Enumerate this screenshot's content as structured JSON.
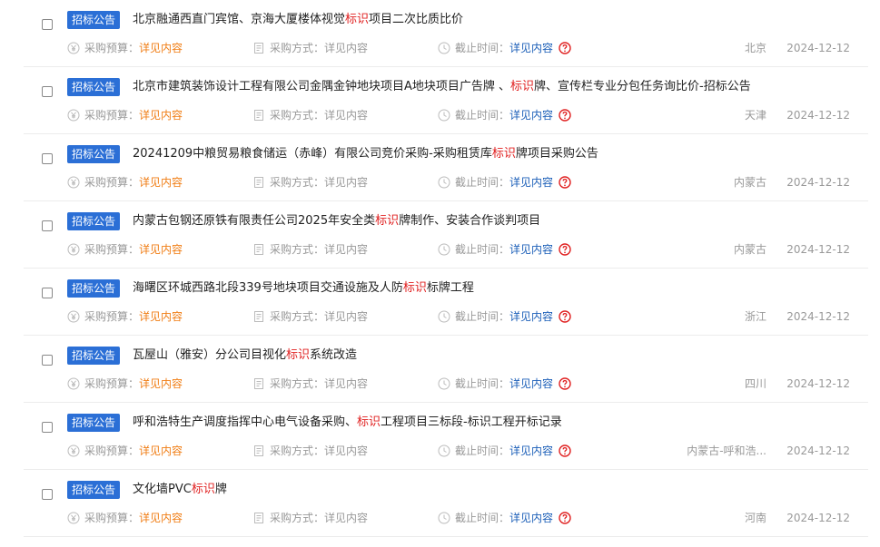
{
  "labels": {
    "badge": "招标公告",
    "budget_label": "采购预算：",
    "budget_value": "详见内容",
    "method_label": "采购方式：",
    "method_value": "详见内容",
    "deadline_label": "截止时间：",
    "deadline_value": "详见内容"
  },
  "colors": {
    "badge": "#2b6fd6",
    "keyword": "#e02020",
    "budget_value": "#f07d14",
    "deadline_value": "#1c5fb8",
    "help_icon": "#e02020"
  },
  "icons": {
    "budget": "yuan-circle-icon",
    "method": "document-icon",
    "deadline": "clock-icon",
    "help": "question-circle-icon"
  },
  "rows": [
    {
      "title_pre": "北京融通西直门宾馆、京海大厦楼体视觉",
      "keyword": "标识",
      "title_post": "项目二次比质比价",
      "region": "北京",
      "date": "2024-12-12"
    },
    {
      "title_pre": "北京市建筑装饰设计工程有限公司金隅金钟地块项目A地块项目广告牌 、",
      "keyword": "标识",
      "title_post": "牌、宣传栏专业分包任务询比价-招标公告",
      "region": "天津",
      "date": "2024-12-12"
    },
    {
      "title_pre": "20241209中粮贸易粮食储运（赤峰）有限公司竞价采购-采购租赁库",
      "keyword": "标识",
      "title_post": "牌项目采购公告",
      "region": "内蒙古",
      "date": "2024-12-12"
    },
    {
      "title_pre": "内蒙古包钢还原铁有限责任公司2025年安全类",
      "keyword": "标识",
      "title_post": "牌制作、安装合作谈判项目",
      "region": "内蒙古",
      "date": "2024-12-12"
    },
    {
      "title_pre": "海曙区环城西路北段339号地块项目交通设施及人防",
      "keyword": "标识",
      "title_post": "标牌工程",
      "region": "浙江",
      "date": "2024-12-12"
    },
    {
      "title_pre": "瓦屋山（雅安）分公司目视化",
      "keyword": "标识",
      "title_post": "系统改造",
      "region": "四川",
      "date": "2024-12-12"
    },
    {
      "title_pre": "呼和浩特生产调度指挥中心电气设备采购、",
      "keyword": "标识",
      "title_post": "工程项目三标段-标识工程开标记录",
      "region": "内蒙古-呼和浩...",
      "date": "2024-12-12"
    },
    {
      "title_pre": "文化墙PVC",
      "keyword": "标识",
      "title_post": "牌",
      "region": "河南",
      "date": "2024-12-12"
    }
  ]
}
